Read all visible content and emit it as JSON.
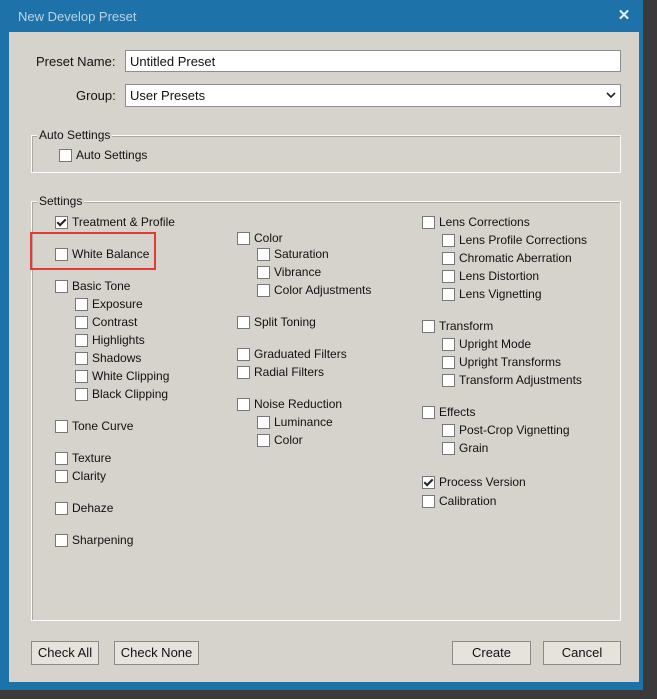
{
  "dialog": {
    "title": "New Develop Preset",
    "close_label": "✕"
  },
  "preset_name": {
    "label": "Preset Name:",
    "value": "Untitled Preset"
  },
  "group": {
    "label": "Group:",
    "value": "User Presets"
  },
  "auto_settings": {
    "legend": "Auto Settings",
    "checkbox": {
      "label": "Auto Settings",
      "checked": false
    }
  },
  "settings": {
    "legend": "Settings",
    "col1": [
      {
        "label": "Treatment & Profile",
        "checked": true
      },
      {
        "label": "White Balance",
        "checked": false
      },
      {
        "label": "Basic Tone",
        "checked": false
      },
      {
        "label": "Exposure",
        "checked": false
      },
      {
        "label": "Contrast",
        "checked": false
      },
      {
        "label": "Highlights",
        "checked": false
      },
      {
        "label": "Shadows",
        "checked": false
      },
      {
        "label": "White Clipping",
        "checked": false
      },
      {
        "label": "Black Clipping",
        "checked": false
      },
      {
        "label": "Tone Curve",
        "checked": false
      },
      {
        "label": "Texture",
        "checked": false
      },
      {
        "label": "Clarity",
        "checked": false
      },
      {
        "label": "Dehaze",
        "checked": false
      },
      {
        "label": "Sharpening",
        "checked": false
      }
    ],
    "col2": [
      {
        "label": "Color",
        "checked": false
      },
      {
        "label": "Saturation",
        "checked": false
      },
      {
        "label": "Vibrance",
        "checked": false
      },
      {
        "label": "Color Adjustments",
        "checked": false
      },
      {
        "label": "Split Toning",
        "checked": false
      },
      {
        "label": "Graduated Filters",
        "checked": false
      },
      {
        "label": "Radial Filters",
        "checked": false
      },
      {
        "label": "Noise Reduction",
        "checked": false
      },
      {
        "label": "Luminance",
        "checked": false
      },
      {
        "label": "Color",
        "checked": false
      }
    ],
    "col3": [
      {
        "label": "Lens Corrections",
        "checked": false
      },
      {
        "label": "Lens Profile Corrections",
        "checked": false
      },
      {
        "label": "Chromatic Aberration",
        "checked": false
      },
      {
        "label": "Lens Distortion",
        "checked": false
      },
      {
        "label": "Lens Vignetting",
        "checked": false
      },
      {
        "label": "Transform",
        "checked": false
      },
      {
        "label": "Upright Mode",
        "checked": false
      },
      {
        "label": "Upright Transforms",
        "checked": false
      },
      {
        "label": "Transform Adjustments",
        "checked": false
      },
      {
        "label": "Effects",
        "checked": false
      },
      {
        "label": "Post-Crop Vignetting",
        "checked": false
      },
      {
        "label": "Grain",
        "checked": false
      },
      {
        "label": "Process Version",
        "checked": true
      },
      {
        "label": "Calibration",
        "checked": false
      }
    ]
  },
  "buttons": {
    "check_all": "Check All",
    "check_none": "Check None",
    "create": "Create",
    "cancel": "Cancel"
  },
  "colors": {
    "title_bar": "#1d72aa",
    "dialog_bg": "#d6d3cc",
    "highlight": "#e53935"
  }
}
